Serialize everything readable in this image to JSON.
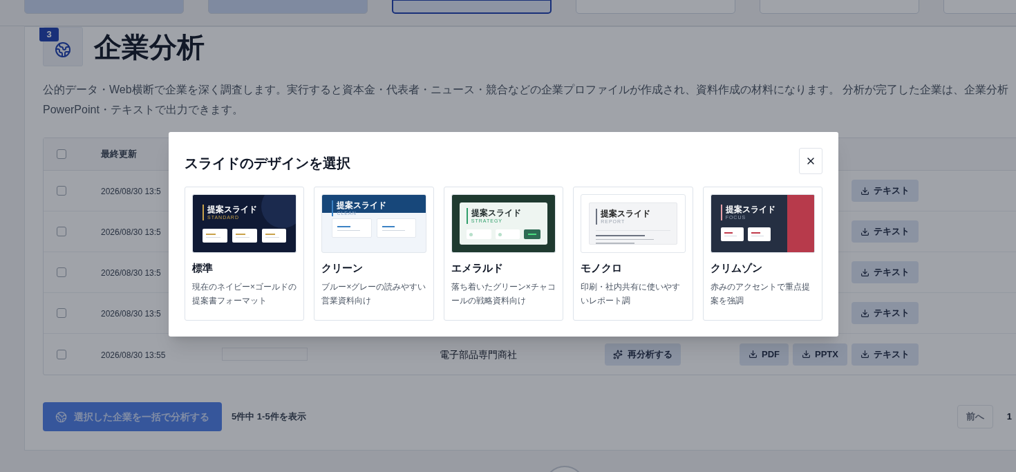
{
  "steps": [
    {
      "completed": true,
      "selected": false
    },
    {
      "completed": true,
      "selected": false
    },
    {
      "completed": false,
      "selected": true
    },
    {
      "completed": false,
      "selected": false
    },
    {
      "completed": false,
      "selected": false
    },
    {
      "completed": false,
      "selected": false
    }
  ],
  "section": {
    "badge": "3",
    "title": "企業分析",
    "description": [
      "公的データ・Web横断で企業を深く調査します。実行すると資本金・代表者・ニュース・競合などの企業プロファイルが作成され、資料作成の材料になります。 分析が完了した企業は、企業分析",
      "PowerPoint・テキストで出力できます。"
    ]
  },
  "table": {
    "select_all": {
      "checked": false
    },
    "columns": [
      "最終更新"
    ],
    "rows": [
      {
        "kind": "covered",
        "checked": false,
        "updated": "2026/08/30 13:5",
        "exports": [
          "テキスト"
        ]
      },
      {
        "kind": "covered",
        "checked": false,
        "updated": "2026/08/30 13:5",
        "exports": [
          "テキスト"
        ]
      },
      {
        "kind": "covered",
        "checked": false,
        "updated": "2026/08/30 13:5",
        "exports": [
          "テキスト"
        ]
      },
      {
        "kind": "covered",
        "checked": false,
        "updated": "2026/08/30 13:5",
        "exports": [
          "テキスト"
        ]
      },
      {
        "kind": "full",
        "checked": false,
        "updated": "2026/08/30 13:55",
        "industry": "電子部品専門商社",
        "reanalyze": "再分析する",
        "exports": [
          "PDF",
          "PPTX",
          "テキスト"
        ]
      }
    ]
  },
  "footer": {
    "bulk_button": {
      "label": "選択した企業を一括で分析する",
      "disabled": true
    },
    "count": "5件中 1-5件を表示",
    "prev": "前へ",
    "page": "1"
  },
  "modal": {
    "title": "スライドのデザインを選択",
    "designs": [
      {
        "kind": "standard",
        "preview_title": "提案スライド",
        "preview_subtitle": "STANDARD",
        "name": "標準",
        "description": "現在のネイビー×ゴールドの提案書フォーマット"
      },
      {
        "kind": "clean",
        "preview_title": "提案スライド",
        "preview_subtitle": "CLEAN",
        "name": "クリーン",
        "description": "ブルー×グレーの読みやすい営業資料向け"
      },
      {
        "kind": "emerald",
        "preview_title": "提案スライド",
        "preview_subtitle": "STRATEGY",
        "name": "エメラルド",
        "description": "落ち着いたグリーン×チャコールの戦略資料向け"
      },
      {
        "kind": "mono",
        "preview_title": "提案スライド",
        "preview_subtitle": "REPORT",
        "name": "モノクロ",
        "description": "印刷・社内共有に使いやすいレポート調"
      },
      {
        "kind": "crimson",
        "preview_title": "提案スライド",
        "preview_subtitle": "FOCUS",
        "name": "クリムゾン",
        "description": "赤みのアクセントで重点提案を強調"
      }
    ]
  }
}
